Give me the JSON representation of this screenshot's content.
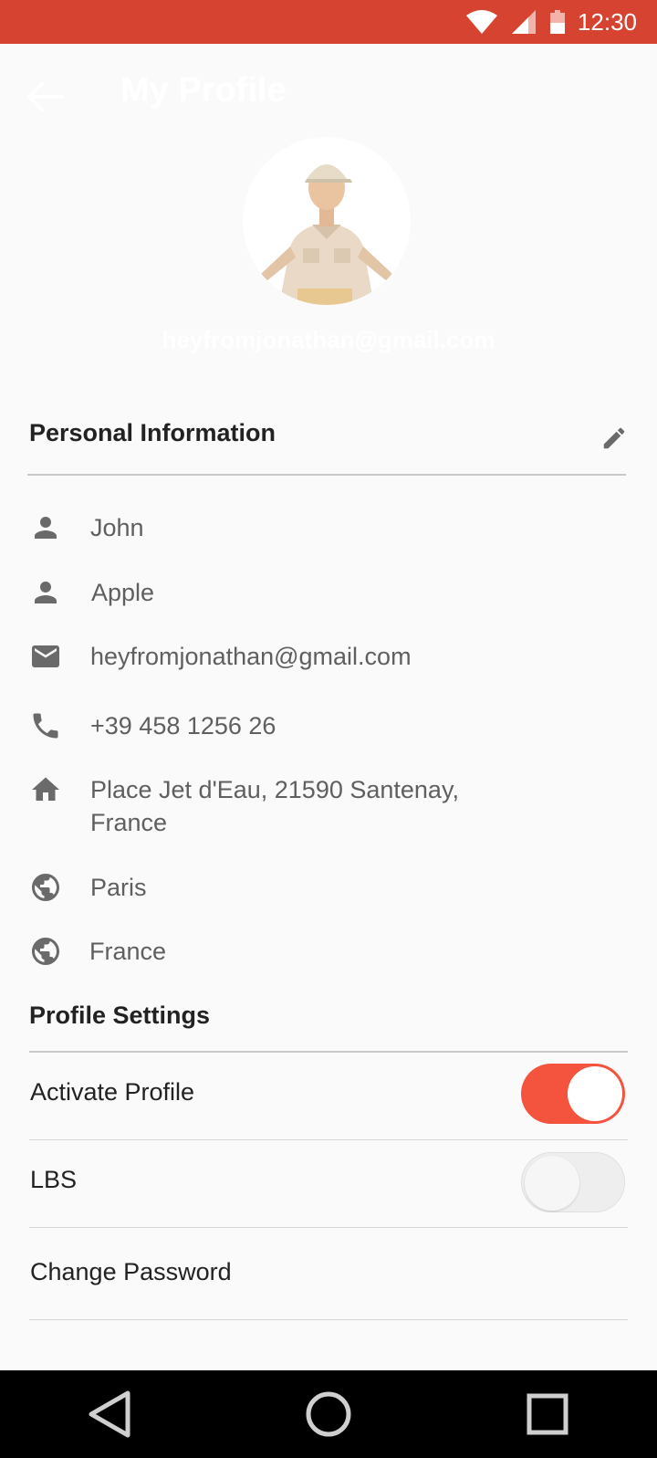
{
  "status_bar": {
    "time": "12:30",
    "icons": [
      "wifi-icon",
      "signal-icon",
      "battery-icon"
    ],
    "background": "#d64331"
  },
  "header": {
    "title": "My Profile",
    "email": "heyfromjonathan@gmail.com"
  },
  "personal_information": {
    "title": "Personal Information",
    "items": [
      {
        "icon": "person-icon",
        "text": "John"
      },
      {
        "icon": "person-icon",
        "text": "Apple"
      },
      {
        "icon": "mail-icon",
        "text": "heyfromjonathan@gmail.com"
      },
      {
        "icon": "phone-icon",
        "text": "+39 458 1256 26"
      },
      {
        "icon": "home-icon",
        "line1": "Place Jet d'Eau, 21590 Santenay,",
        "line2": "France"
      },
      {
        "icon": "globe-icon",
        "text": "Paris"
      },
      {
        "icon": "globe-icon",
        "text": "France"
      }
    ]
  },
  "profile_settings": {
    "title": "Profile Settings",
    "activate_profile": {
      "label": "Activate Profile",
      "on": true
    },
    "lbs": {
      "label": "LBS",
      "on": false
    },
    "change_password": "Change Password"
  },
  "colors": {
    "accent": "#f4533e",
    "icon_gray": "#6a6a6a"
  }
}
